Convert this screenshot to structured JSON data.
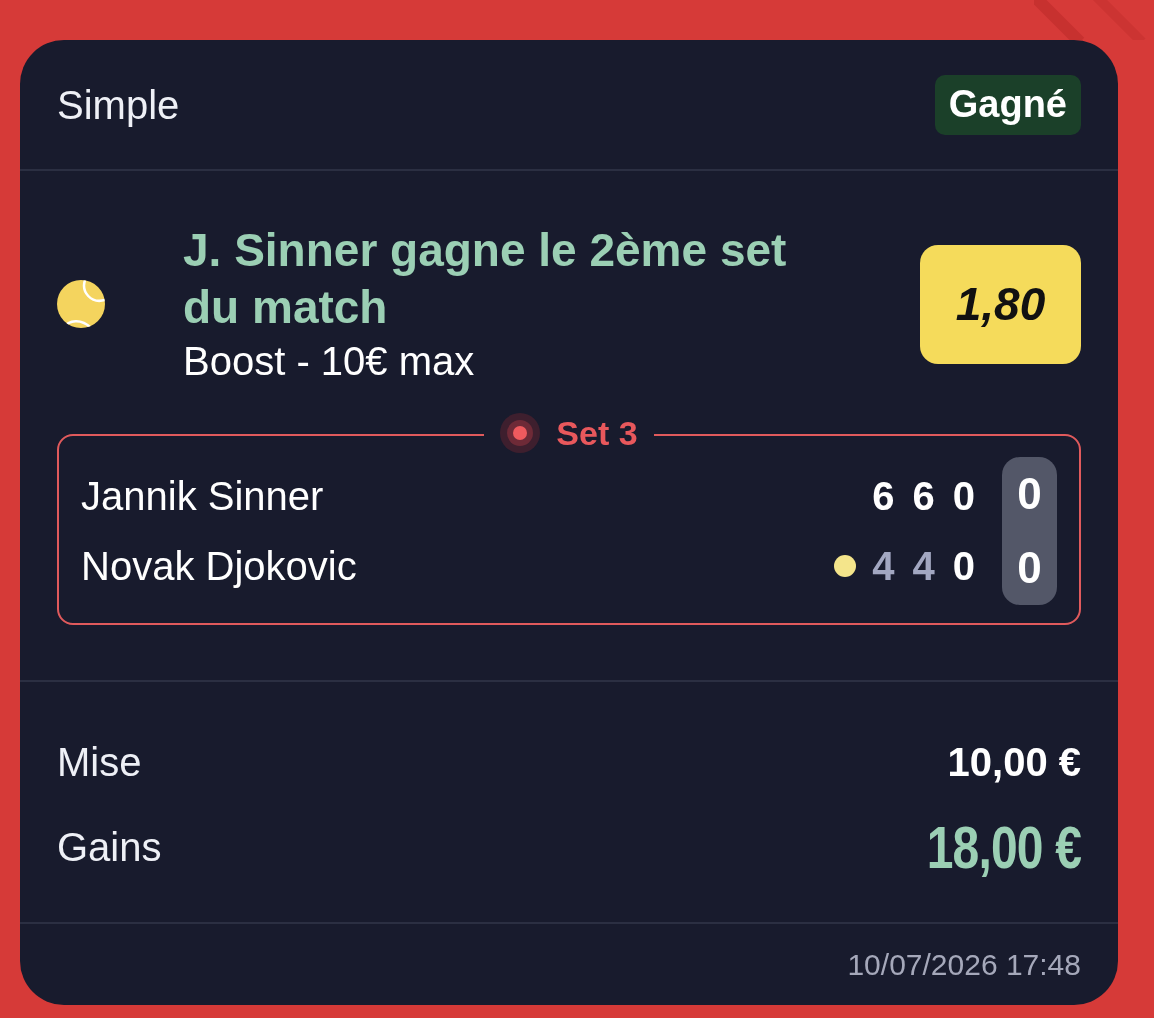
{
  "bet": {
    "type": "Simple",
    "status": {
      "label": "Gagné",
      "kind": "won"
    }
  },
  "selection": {
    "title": "J. Sinner gagne le 2ème set du match",
    "subtitle": "Boost - 10€ max",
    "odds": "1,80"
  },
  "scoreboard": {
    "period": "Set 3",
    "live": true,
    "players": [
      {
        "name": "Jannik Sinner",
        "serving": false,
        "sets": [
          {
            "score": "6",
            "lost": false
          },
          {
            "score": "6",
            "lost": false
          },
          {
            "score": "0",
            "lost": false
          }
        ],
        "points": "0"
      },
      {
        "name": "Novak Djokovic",
        "serving": true,
        "sets": [
          {
            "score": "4",
            "lost": true
          },
          {
            "score": "4",
            "lost": true
          },
          {
            "score": "0",
            "lost": false
          }
        ],
        "points": "0"
      }
    ]
  },
  "amounts": [
    {
      "label": "Mise",
      "value": "10,00 €",
      "kind": "stake"
    },
    {
      "label": "Gains",
      "value": "18,00 €",
      "kind": "payout"
    }
  ],
  "footer": {
    "date": "10/07/2026 17:48"
  }
}
